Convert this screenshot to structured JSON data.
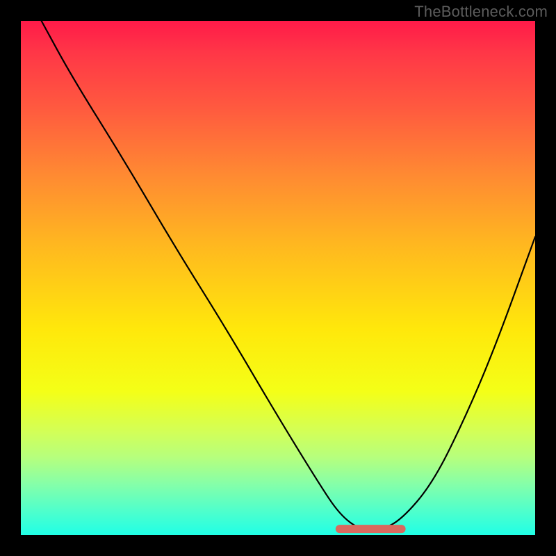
{
  "watermark": {
    "text": "TheBottleneck.com"
  },
  "chart_data": {
    "type": "line",
    "title": "",
    "xlabel": "",
    "ylabel": "",
    "xlim": [
      0,
      100
    ],
    "ylim": [
      0,
      100
    ],
    "grid": false,
    "legend": false,
    "background_gradient": {
      "direction": "vertical",
      "stops": [
        {
          "pct": 0,
          "color": "#ff1a49"
        },
        {
          "pct": 60,
          "color": "#ffe80b"
        },
        {
          "pct": 100,
          "color": "#20ffe6"
        }
      ]
    },
    "series": [
      {
        "name": "bottleneck-curve",
        "x": [
          4,
          10,
          20,
          30,
          40,
          50,
          58,
          62,
          66,
          70,
          74,
          80,
          86,
          92,
          100
        ],
        "y": [
          100,
          89,
          73,
          56,
          40,
          23,
          10,
          4,
          1,
          1,
          3,
          10,
          22,
          36,
          58
        ]
      }
    ],
    "highlight_segment": {
      "name": "optimal-range",
      "x_start": 62,
      "x_end": 74,
      "y": 1.2,
      "color": "#d9695e"
    }
  }
}
